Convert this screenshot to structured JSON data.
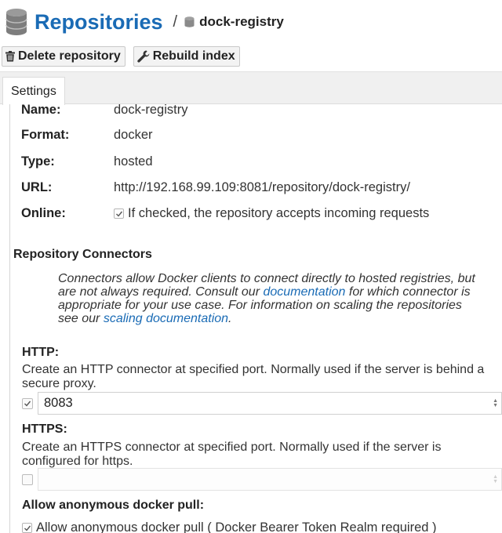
{
  "header": {
    "title": "Repositories",
    "separator": "/",
    "repo_name": "dock-registry"
  },
  "toolbar": {
    "delete_label": "Delete repository",
    "rebuild_label": "Rebuild index"
  },
  "tabs": [
    {
      "label": "Settings"
    }
  ],
  "settings": {
    "name": {
      "label": "Name:",
      "value": "dock-registry"
    },
    "format": {
      "label": "Format:",
      "value": "docker"
    },
    "type": {
      "label": "Type:",
      "value": "hosted"
    },
    "url": {
      "label": "URL:",
      "value": "http://192.168.99.109:8081/repository/dock-registry/"
    },
    "online": {
      "label": "Online:",
      "checked": true,
      "text": "If checked, the repository accepts incoming requests"
    }
  },
  "connectors": {
    "heading": "Repository Connectors",
    "help_1": "Connectors allow Docker clients to connect directly to hosted registries, but are not always required. Consult our",
    "help_link_1": "documentation",
    "help_2": "for which connector is appropriate for your use case. For information on scaling the repositories see our",
    "help_link_2": "scaling documentation",
    "help_3": ".",
    "http": {
      "label": "HTTP:",
      "description": "Create an HTTP connector at specified port. Normally used if the server is behind a secure proxy.",
      "enabled": true,
      "port": "8083"
    },
    "https": {
      "label": "HTTPS:",
      "description": "Create an HTTPS connector at specified port. Normally used if the server is configured for https.",
      "enabled": false,
      "port": ""
    }
  },
  "anonymous": {
    "label": "Allow anonymous docker pull:",
    "checked": true,
    "text": "Allow anonymous docker pull ( Docker Bearer Token Realm required )"
  },
  "colors": {
    "link": "#1a6bb5",
    "title": "#1a6bb5",
    "tab_strip": "#f0f0f0"
  }
}
